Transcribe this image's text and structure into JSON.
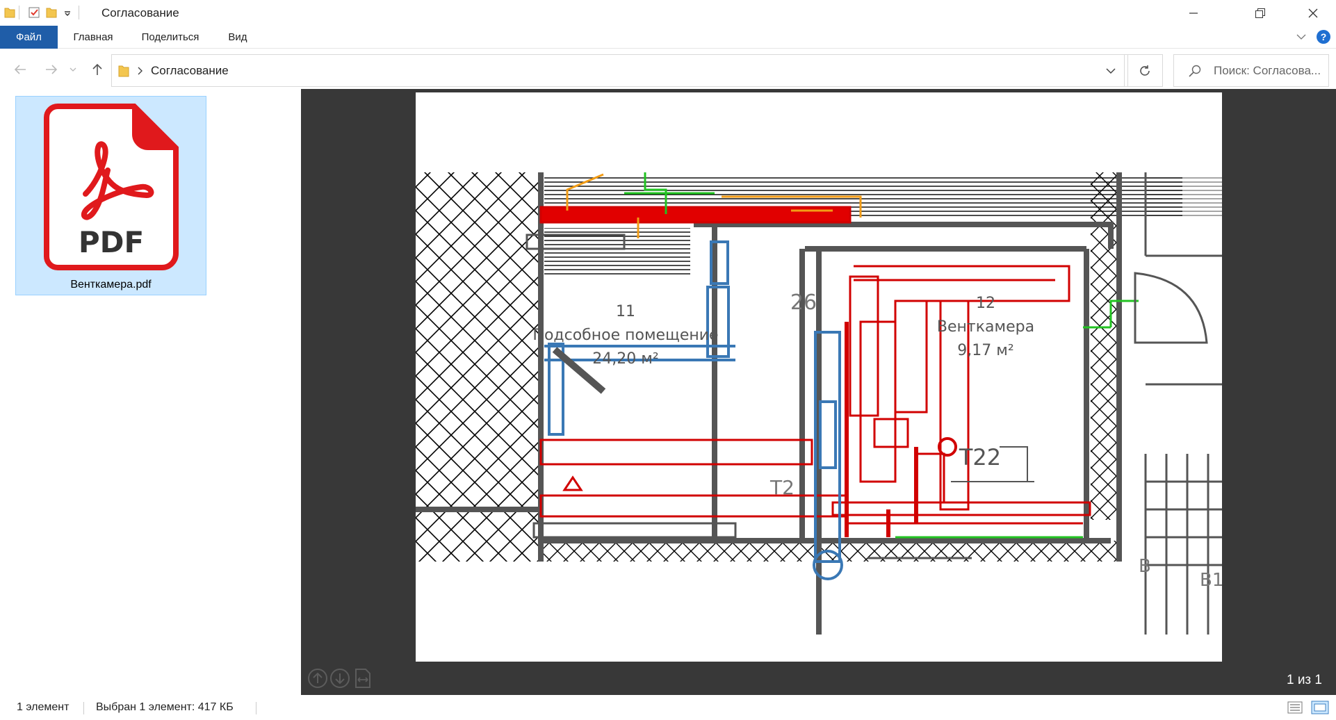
{
  "window": {
    "title": "Согласование"
  },
  "ribbon": {
    "tabs": [
      "Файл",
      "Главная",
      "Поделиться",
      "Вид"
    ]
  },
  "address": {
    "path": "Согласование",
    "search_placeholder": "Поиск: Согласова..."
  },
  "files": [
    {
      "name": "Венткамера.pdf",
      "icon": "pdf-file-icon",
      "icon_text": "PDF"
    }
  ],
  "preview": {
    "page_indicator": "1 из 1",
    "drawing": {
      "rooms": [
        {
          "number": "11",
          "name": "Подсобное помещение",
          "area": "24,20 м²"
        },
        {
          "number": "12",
          "name": "Венткамера",
          "area": "9,17 м²"
        }
      ],
      "tags": [
        "Т22",
        "Т2",
        "26",
        "В1",
        "В"
      ]
    }
  },
  "status": {
    "count": "1 элемент",
    "selection": "Выбран 1 элемент: 417 КБ"
  },
  "colors": {
    "file_tab": "#1f5da8",
    "selection_bg": "#cce8ff",
    "preview_bg": "#383838",
    "pdf_red": "#e0191c"
  }
}
